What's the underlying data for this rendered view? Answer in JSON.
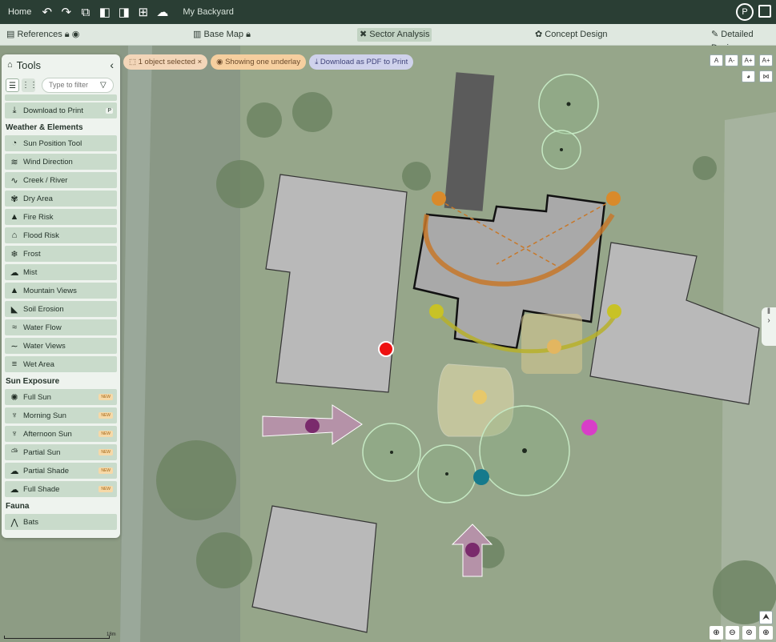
{
  "topbar": {
    "home": "Home",
    "icons": [
      "undo-icon",
      "redo-icon",
      "copy-icon",
      "layer-front-icon",
      "layer-back-icon",
      "group-icon",
      "cloud-icon"
    ],
    "project": "My Backyard",
    "avatar": "P"
  },
  "phases": {
    "references": "References",
    "base_map": "Base Map",
    "sector_analysis": "Sector Analysis",
    "concept_design": "Concept Design",
    "detailed_design": "Detailed Design"
  },
  "tools": {
    "title": "Tools",
    "filter_placeholder": "Type to filter",
    "download": "Download to Print",
    "download_badge": "P",
    "sections": {
      "weather": "Weather & Elements",
      "sun": "Sun Exposure",
      "fauna": "Fauna"
    },
    "weather_items": [
      "Sun Position Tool",
      "Wind Direction",
      "Creek / River",
      "Dry Area",
      "Fire Risk",
      "Flood Risk",
      "Frost",
      "Mist",
      "Mountain Views",
      "Soil Erosion",
      "Water Flow",
      "Water Views",
      "Wet Area"
    ],
    "sun_items": [
      "Full Sun",
      "Morning Sun",
      "Afternoon Sun",
      "Partial Sun",
      "Partial Shade",
      "Full Shade"
    ],
    "new_badge": "NEW",
    "fauna_items": [
      "Bats"
    ]
  },
  "chips": {
    "selected": "1 object selected",
    "underlay": "Showing one underlay",
    "pdf": "Download as PDF to Print"
  },
  "text_controls": [
    "A",
    "A-",
    "A+",
    "A+"
  ],
  "scale_label": "18m",
  "colors": {
    "topbar": "#2a3e34",
    "panel": "#eef3ee",
    "tool_item": "#c9dbcb",
    "accent_orange": "#d98a2b",
    "accent_yellow": "#c8c226",
    "wind": "#7a3a6c"
  }
}
